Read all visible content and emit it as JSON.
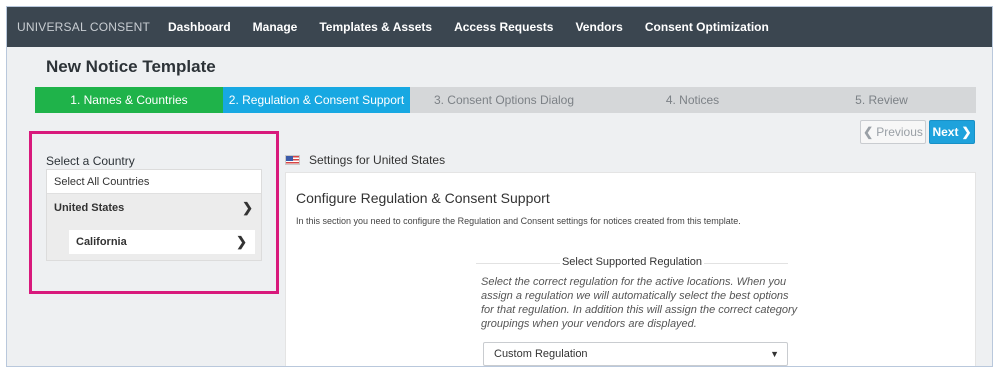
{
  "topnav": {
    "brand": "UNIVERSAL CONSENT",
    "items": [
      "Dashboard",
      "Manage",
      "Templates & Assets",
      "Access Requests",
      "Vendors",
      "Consent Optimization"
    ]
  },
  "page_title": "New Notice Template",
  "steps": [
    {
      "label": "1. Names & Countries",
      "state": "done"
    },
    {
      "label": "2. Regulation & Consent Support",
      "state": "active"
    },
    {
      "label": "3. Consent Options Dialog",
      "state": "pending"
    },
    {
      "label": "4. Notices",
      "state": "pending"
    },
    {
      "label": "5. Review",
      "state": "pending"
    }
  ],
  "buttons": {
    "previous": "Previous",
    "next": "Next"
  },
  "country_selector": {
    "label": "Select a Country",
    "select_all": "Select All Countries",
    "country": "United States",
    "state": "California"
  },
  "settings": {
    "header": "Settings for United States",
    "section_title": "Configure Regulation & Consent Support",
    "section_desc": "In this section you need to configure the Regulation and Consent settings for notices created from this template.",
    "regulation_heading": "Select Supported Regulation",
    "regulation_desc": "Select the correct regulation for the active locations. When you assign a regulation we will automatically select the best options for that regulation. In addition this will assign the correct category groupings when your vendors are displayed.",
    "regulation_value": "Custom Regulation"
  },
  "colors": {
    "nav_bg": "#3b4650",
    "step_done": "#1fb34a",
    "step_active": "#17a8e2",
    "next_button": "#1ea2dc",
    "highlight": "#d8197c"
  },
  "icons": {
    "prev": "chevron-left-icon",
    "next": "chevron-right-icon",
    "row": "chevron-right-icon",
    "flag": "us-flag-icon",
    "select": "caret-down-icon"
  }
}
